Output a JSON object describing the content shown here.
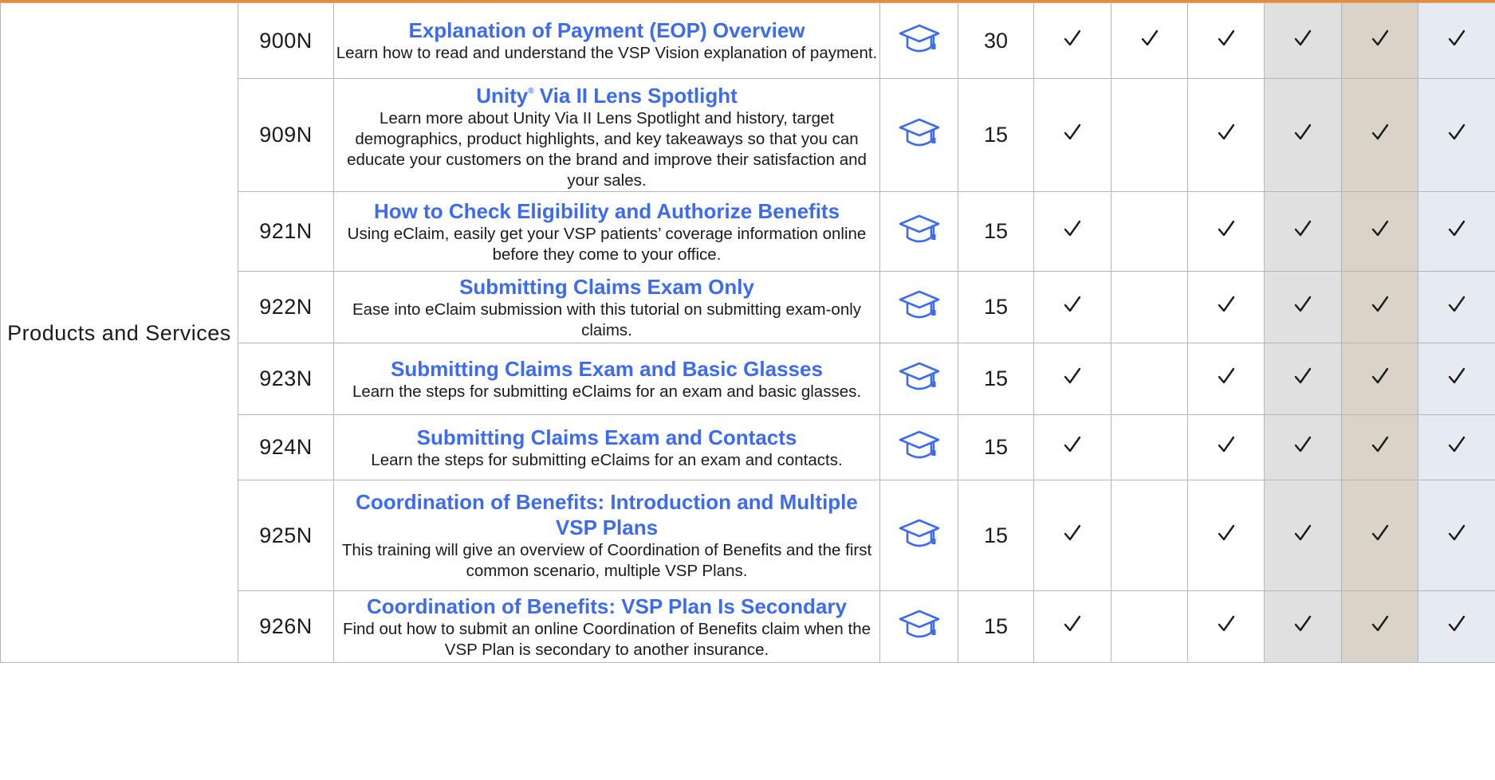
{
  "category": "Products and Services",
  "check_glyph": "✓",
  "rows": [
    {
      "code": "900N",
      "title": "Explanation of Payment (EOP) Overview",
      "title_sup": "",
      "title_rest": "",
      "description": "Learn how to read and understand the VSP Vision explanation of payment.",
      "icon": "graduation-cap-icon",
      "minutes": "30",
      "checks": [
        true,
        true,
        true,
        true,
        true,
        true
      ]
    },
    {
      "code": "909N",
      "title": "Unity",
      "title_sup": "®",
      "title_rest": " Via II Lens Spotlight",
      "description": "Learn more about Unity Via II Lens Spotlight and history, target demographics, product highlights, and key takeaways so that you can educate your customers on the brand and improve their satisfaction and your sales.",
      "icon": "graduation-cap-icon",
      "minutes": "15",
      "checks": [
        true,
        false,
        true,
        true,
        true,
        true
      ]
    },
    {
      "code": "921N",
      "title": "How to Check Eligibility and Authorize Benefits",
      "title_sup": "",
      "title_rest": "",
      "description": "Using eClaim, easily get your VSP patients’ coverage information online before they come to your office.",
      "icon": "graduation-cap-icon",
      "minutes": "15",
      "checks": [
        true,
        false,
        true,
        true,
        true,
        true
      ]
    },
    {
      "code": "922N",
      "title": "Submitting Claims Exam Only",
      "title_sup": "",
      "title_rest": "",
      "description": "Ease into eClaim submission with this tutorial on submitting exam-only claims.",
      "icon": "graduation-cap-icon",
      "minutes": "15",
      "checks": [
        true,
        false,
        true,
        true,
        true,
        true
      ]
    },
    {
      "code": "923N",
      "title": "Submitting Claims Exam and Basic Glasses",
      "title_sup": "",
      "title_rest": "",
      "description": "Learn the steps for submitting eClaims for an exam and basic glasses.",
      "icon": "graduation-cap-icon",
      "minutes": "15",
      "checks": [
        true,
        false,
        true,
        true,
        true,
        true
      ]
    },
    {
      "code": "924N",
      "title": "Submitting Claims Exam and Contacts",
      "title_sup": "",
      "title_rest": "",
      "description": "Learn the steps for submitting eClaims for an exam and contacts.",
      "icon": "graduation-cap-icon",
      "minutes": "15",
      "checks": [
        true,
        false,
        true,
        true,
        true,
        true
      ]
    },
    {
      "code": "925N",
      "title": "Coordination of Benefits: Introduction and Multiple VSP Plans",
      "title_sup": "",
      "title_rest": "",
      "description": "This training will give an overview of Coordination of Benefits and the first common scenario, multiple VSP Plans.",
      "icon": "graduation-cap-icon",
      "minutes": "15",
      "checks": [
        true,
        false,
        true,
        true,
        true,
        true
      ]
    },
    {
      "code": "926N",
      "title": "Coordination of Benefits: VSP Plan Is Secondary",
      "title_sup": "",
      "title_rest": "",
      "description": "Find out how to submit an online Coordination of Benefits claim when the VSP Plan is secondary to another insurance.",
      "icon": "graduation-cap-icon",
      "minutes": "15",
      "checks": [
        true,
        false,
        true,
        true,
        true,
        true
      ]
    }
  ],
  "colors": {
    "accent_orange": "#f08a2c",
    "title_blue": "#3d6bf0",
    "shade_gray": "#e0e0e0",
    "shade_tan": "#dad3c8",
    "shade_blue": "#e6ebf1"
  }
}
